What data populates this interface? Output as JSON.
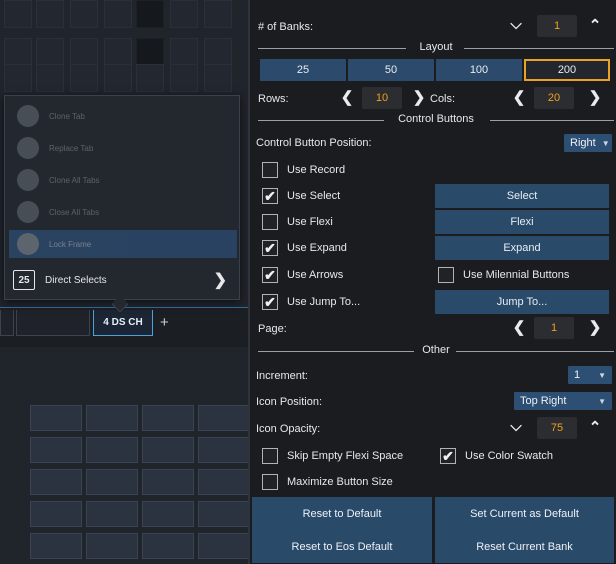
{
  "background": {
    "popup": {
      "items": [
        {
          "label": "Clone Tab",
          "icon": "circle-icon"
        },
        {
          "label": "Replace Tab",
          "icon": "circle-icon"
        },
        {
          "label": "Clone All Tabs",
          "icon": "circle-icon"
        },
        {
          "label": "Close All Tabs",
          "icon": "circle-icon"
        },
        {
          "label": "Lock Frame",
          "icon": "lock-icon"
        }
      ],
      "direct_selects": {
        "icon_text": "25",
        "label": "Direct Selects"
      }
    },
    "tab_active_label": "4 DS CH",
    "tab_add_label": "+"
  },
  "settings": {
    "num_banks_label": "# of Banks:",
    "num_banks_value": "1",
    "layout_title": "Layout",
    "layout_options": [
      "25",
      "50",
      "100",
      "200"
    ],
    "layout_selected": "200",
    "rows_label": "Rows:",
    "rows_value": "10",
    "cols_label": "Cols:",
    "cols_value": "20",
    "control_buttons_title": "Control Buttons",
    "control_button_position_label": "Control Button Position:",
    "control_button_position_value": "Right",
    "checks": {
      "use_record": {
        "label": "Use Record",
        "checked": false
      },
      "use_select": {
        "label": "Use Select",
        "checked": true
      },
      "use_flexi": {
        "label": "Use Flexi",
        "checked": false
      },
      "use_expand": {
        "label": "Use Expand",
        "checked": true
      },
      "use_arrows": {
        "label": "Use Arrows",
        "checked": true
      },
      "use_milennial": {
        "label": "Use Milennial Buttons",
        "checked": false
      },
      "use_jump_to": {
        "label": "Use Jump To...",
        "checked": true
      },
      "skip_empty": {
        "label": "Skip Empty Flexi Space",
        "checked": false
      },
      "use_color_swatch": {
        "label": "Use Color Swatch",
        "checked": true
      },
      "maximize_button": {
        "label": "Maximize Button Size",
        "checked": false
      }
    },
    "buttons": {
      "select": "Select",
      "flexi": "Flexi",
      "expand": "Expand",
      "jump_to": "Jump To..."
    },
    "page_label": "Page:",
    "page_value": "1",
    "other_title": "Other",
    "increment_label": "Increment:",
    "increment_value": "1",
    "icon_position_label": "Icon Position:",
    "icon_position_value": "Top Right",
    "icon_opacity_label": "Icon Opacity:",
    "icon_opacity_value": "75",
    "footer": {
      "reset_default": "Reset to Default",
      "set_current_default": "Set Current as Default",
      "reset_eos": "Reset to Eos Default",
      "reset_current_bank": "Reset Current Bank"
    }
  },
  "colors": {
    "accent_orange": "#f0a020",
    "button_blue": "#2a4a6a",
    "panel_bg": "#1a1c1f"
  }
}
